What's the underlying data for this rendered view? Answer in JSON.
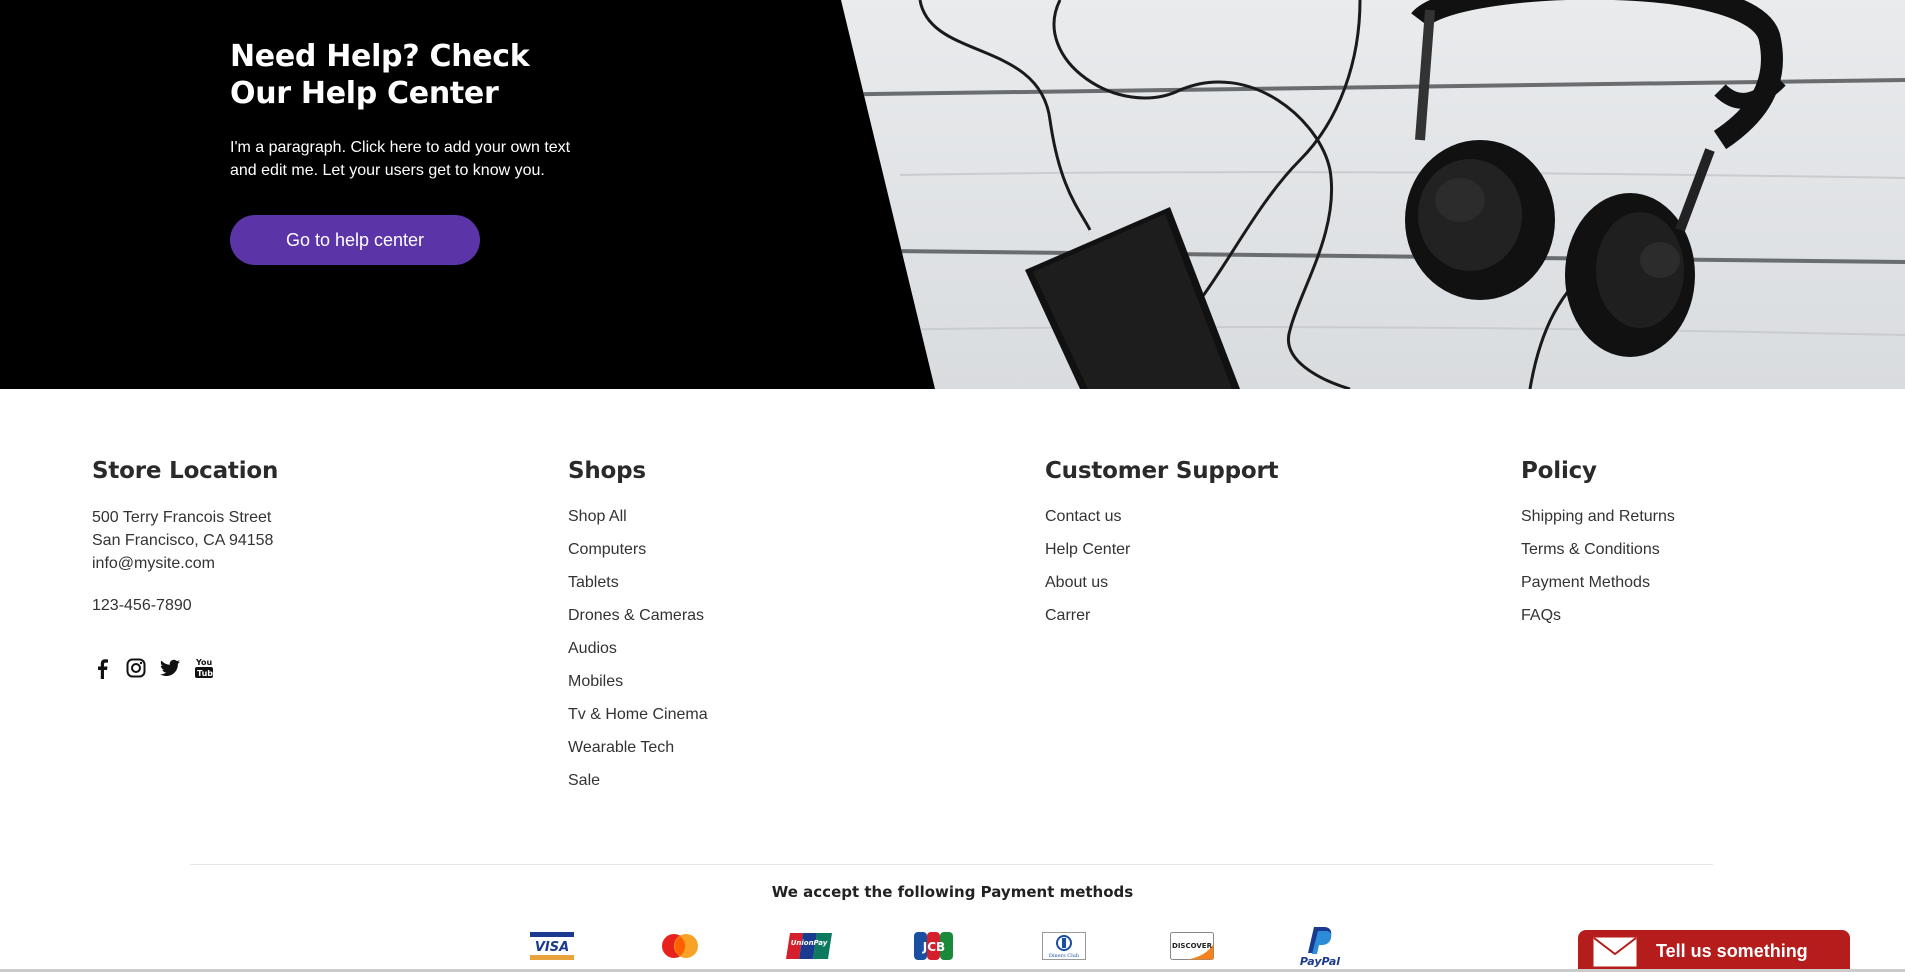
{
  "hero": {
    "title_line1": "Need Help? Check",
    "title_line2": "Our Help Center",
    "paragraph": "I'm a paragraph. Click here to add your own text and edit me. Let your users get to know you.",
    "button_label": "Go to help center"
  },
  "store": {
    "heading": "Store Location",
    "address_line1": "500 Terry Francois Street",
    "address_line2": "San Francisco, CA 94158",
    "email": "info@mysite.com",
    "phone": "123-456-7890",
    "social_icons": [
      "facebook-icon",
      "instagram-icon",
      "twitter-icon",
      "youtube-icon"
    ]
  },
  "shops": {
    "heading": "Shops",
    "items": [
      "Shop All",
      "Computers",
      "Tablets",
      "Drones & Cameras",
      "Audios",
      "Mobiles",
      "Tv & Home Cinema",
      "Wearable Tech",
      "Sale"
    ]
  },
  "support": {
    "heading": "Customer Support",
    "items": [
      "Contact us",
      "Help Center",
      "About us",
      "Carrer"
    ]
  },
  "policy": {
    "heading": "Policy",
    "items": [
      "Shipping and Returns",
      "Terms & Conditions",
      "Payment Methods",
      "FAQs"
    ]
  },
  "payments": {
    "title": "We accept the following Payment methods",
    "logos": [
      "visa-icon",
      "mastercard-icon",
      "unionpay-icon",
      "jcb-icon",
      "diners-club-icon",
      "discover-icon",
      "paypal-icon"
    ],
    "visa_text": "VISA",
    "unionpay_text": "UnionPay",
    "jcb_text": "JCB",
    "diners_text": "Diners Club",
    "discover_text": "DISCOVER",
    "paypal_text": "PayPal"
  },
  "chat": {
    "label": "Tell us something"
  },
  "colors": {
    "accent": "#5b35a7",
    "chat": "#b51c1c"
  }
}
